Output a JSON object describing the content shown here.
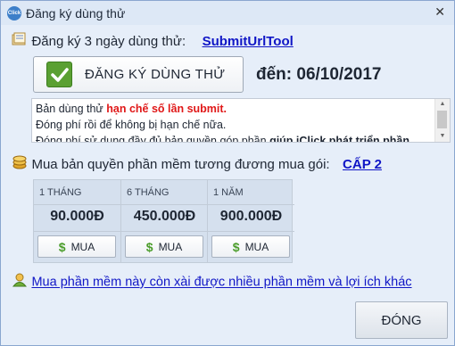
{
  "window": {
    "title": "Đăng ký dùng thử",
    "app_icon_text": "Click"
  },
  "trial": {
    "label": "Đăng ký 3 ngày dùng thử:",
    "product_link": "SubmitUrlTool",
    "button_label": "ĐĂNG KÝ DÙNG THỬ",
    "expiry": "đến: 06/10/2017"
  },
  "info": {
    "line1_prefix": "Bản dùng thử ",
    "line1_highlight": "hạn chế số lần submit.",
    "line2": "Đóng phí rồi để không bị hạn chế nữa.",
    "line3_prefix": "Đóng phí sử dụng đầy đủ bản quyền góp phần ",
    "line3_bold": "giúp iClick phát triển phần"
  },
  "purchase": {
    "label": "Mua bản quyền phần mềm tương đương mua gói:",
    "package_link": "CẤP 2",
    "plans": [
      {
        "period": "1 THÁNG",
        "price": "90.000Đ",
        "buy_label": "MUA"
      },
      {
        "period": "6 THÁNG",
        "price": "450.000Đ",
        "buy_label": "MUA"
      },
      {
        "period": "1 NĂM",
        "price": "900.000Đ",
        "buy_label": "MUA"
      }
    ]
  },
  "more_link": "Mua phần mềm này còn xài được nhiều phần mềm và lợi ích khác",
  "close_button": "ĐÓNG",
  "colors": {
    "link": "#1016c6",
    "highlight_red": "#e01818",
    "check_green": "#5aa032",
    "background": "#e6eef9"
  }
}
